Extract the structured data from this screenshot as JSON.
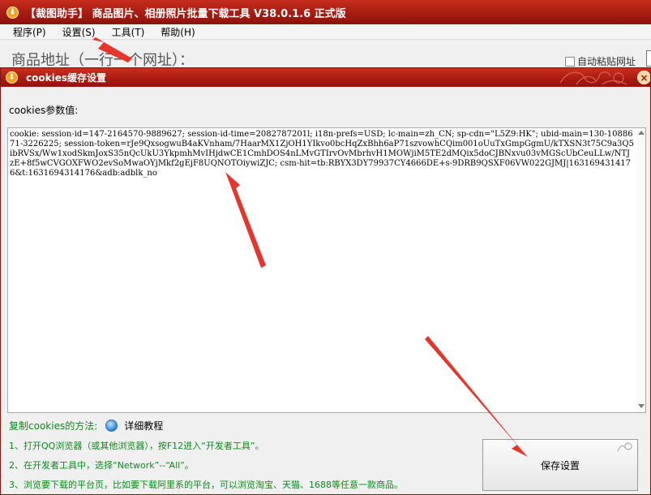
{
  "main_window": {
    "title": "【裁图助手】 商品图片、相册照片批量下载工具 V38.0.1.6 正式版",
    "app_icon_glyph": "⬇",
    "menu": [
      "程序(P)",
      "设置(S)",
      "工具(T)",
      "帮助(H)"
    ],
    "url_label": "商品地址（一行一个网址）：",
    "auto_paste_label": "自动粘贴网址"
  },
  "dialog": {
    "title": "cookies缓存设置",
    "close_glyph": "×",
    "param_label": "cookies参数值:",
    "cookie_value": "cookie: session-id=147-2164570-9889627; session-id-time=2082787201l; i18n-prefs=USD; lc-main=zh_CN; sp-cdn=\"L5Z9:HK\"; ubid-main=130-1088671-3226225; session-token=rJe9QxsogwuB4aKVnham/7HaarMX1ZjOH1YIkvo0bcHqZxBhh6aP71szvowhCQim001oUuTxGmpGgmU/kTXSN3t75C9a3Q5ibRVSx/Ww1xodSkmJoxS35nQcUkU3YkpmhMvIHjdwCE1CmhDOS4nLMvGTIrvOvMbrhvH1MOWjiM5TE2dMQix5doCJBNxvu03vMGScUbCeuLLw/NTJzE+8f5wCVGOXFWO2evSoMwaOYjMkf2gEjF8UQNOTOiywiZJC; csm-hit=tb:RBYX3DY79937CY4666DE+s-9DRB9QSXF06VW022GJMJ|1631694314176&t:1631694314176&adb:adblk_no",
    "help_label": "复制cookies的方法:",
    "help_link": "详细教程",
    "steps": [
      "1、打开QQ浏览器（或其他浏览器），按F12进入“开发者工具”。",
      "2、在开发者工具中，选择“Network”--“All”。",
      "3、浏览要下载的平台页，比如要下载阿里系的平台，可以浏览淘宝、天猫、1688等任意一款商品。"
    ],
    "save_button": "保存设置"
  },
  "colors": {
    "title_red": "#a81a10",
    "help_green": "#0c8a1a",
    "arrow_red": "#e8352c"
  }
}
